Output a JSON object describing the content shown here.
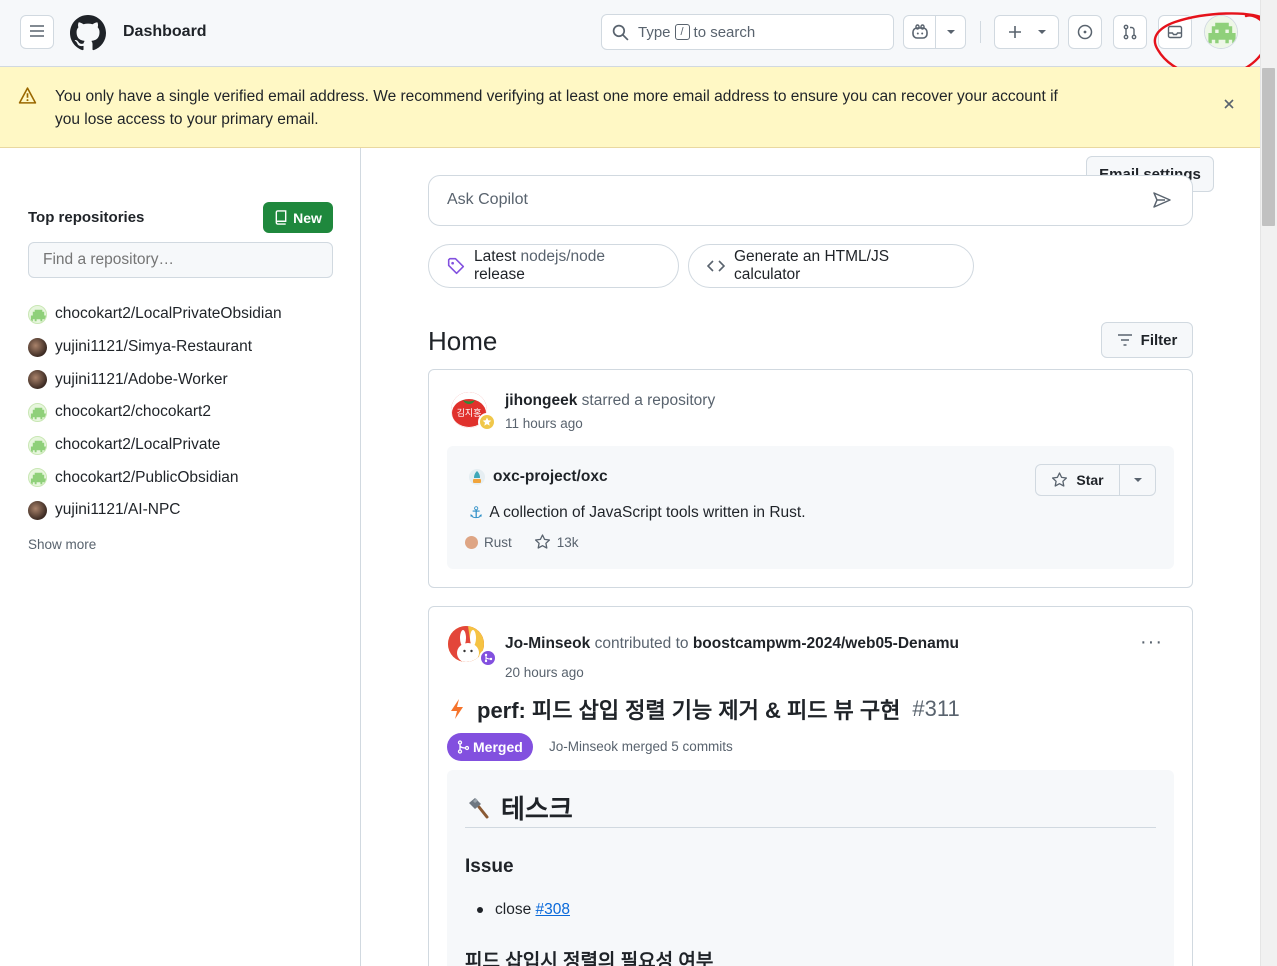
{
  "header": {
    "title": "Dashboard",
    "search_prefix": "Type",
    "search_key": "/",
    "search_suffix": "to search"
  },
  "banner": {
    "message": "You only have a single verified email address. We recommend verifying at least one more email address to ensure you can recover your account if you lose access to your primary email.",
    "button_label": "Email settings"
  },
  "sidebar": {
    "heading": "Top repositories",
    "new_label": "New",
    "find_placeholder": "Find a repository…",
    "repos": [
      "chocokart2/LocalPrivateObsidian",
      "yujini1121/Simya-Restaurant",
      "yujini1121/Adobe-Worker",
      "chocokart2/chocokart2",
      "chocokart2/LocalPrivate",
      "chocokart2/PublicObsidian",
      "yujini1121/AI-NPC"
    ],
    "show_more": "Show more"
  },
  "copilot": {
    "placeholder": "Ask Copilot",
    "chip1_prefix": "Latest",
    "chip1_repo": "nodejs/node",
    "chip1_suffix": "release",
    "chip2": "Generate an HTML/JS calculator"
  },
  "home": {
    "title": "Home",
    "filter_label": "Filter"
  },
  "feed1": {
    "avatar_text": "김지홍",
    "actor": "jihongeek",
    "action": "starred a repository",
    "time": "11 hours ago",
    "repo": "oxc-project/oxc",
    "description": "A collection of JavaScript tools written in Rust.",
    "language": "Rust",
    "stars": "13k",
    "star_label": "Star"
  },
  "feed2": {
    "actor": "Jo-Minseok",
    "action": "contributed to",
    "repo": "boostcampwm-2024/web05-Denamu",
    "time": "20 hours ago",
    "pr_title": "perf: 피드 삽입 정렬 기능 제거 & 피드 뷰 구현",
    "pr_number": "#311",
    "status": "Merged",
    "merged_by": "Jo-Minseok merged 5 commits",
    "body_heading": "테스크",
    "body_subheading": "Issue",
    "body_item_text": "close",
    "body_item_link": "#308",
    "body_next_heading": "피드 삽입시 정렬의 필요성 여부"
  },
  "colors": {
    "green_button": "#1f883d",
    "merged_purple": "#8250df",
    "banner_yellow": "#fff8c5",
    "link_blue": "#0969da",
    "annotation_red": "#e5121b"
  }
}
